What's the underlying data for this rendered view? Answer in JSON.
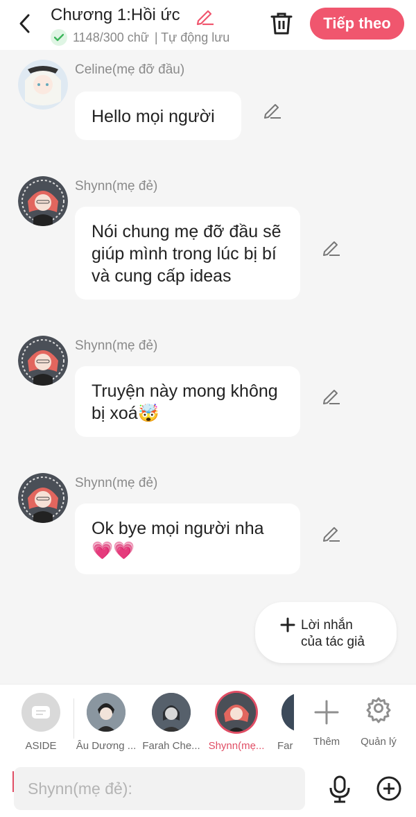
{
  "header": {
    "title": "Chương 1:Hồi ức",
    "word_count": "1148/300 chữ",
    "autosave": "| Tự động lưu",
    "next_button": "Tiếp theo",
    "accent": "#f0566e"
  },
  "messages": [
    {
      "name": "Celine(mẹ đỡ đầu)",
      "text": "Hello mọi người"
    },
    {
      "name": "Shynn(mẹ đẻ)",
      "text": "Nói chung mẹ đỡ đầu sẽ giúp mình trong lúc bị bí và cung cấp ideas"
    },
    {
      "name": "Shynn(mẹ đẻ)",
      "text": "Truyện này mong không bị xoá🤯"
    },
    {
      "name": "Shynn(mẹ đẻ)",
      "text": "Ok bye mọi người nha 💗💗"
    }
  ],
  "author_note": {
    "label_line1": "Lời nhắn",
    "label_line2": "của tác giả"
  },
  "characters": [
    {
      "label": "ASIDE",
      "icon": "chat-bubble-icon"
    },
    {
      "label": "Âu Dương ..."
    },
    {
      "label": "Farah Che..."
    },
    {
      "label": "Shynn(mẹ...",
      "active": true
    },
    {
      "label": "Far"
    }
  ],
  "actions": {
    "add": "Thêm",
    "manage": "Quản lý"
  },
  "input": {
    "placeholder": "Shynn(mẹ đẻ):"
  }
}
